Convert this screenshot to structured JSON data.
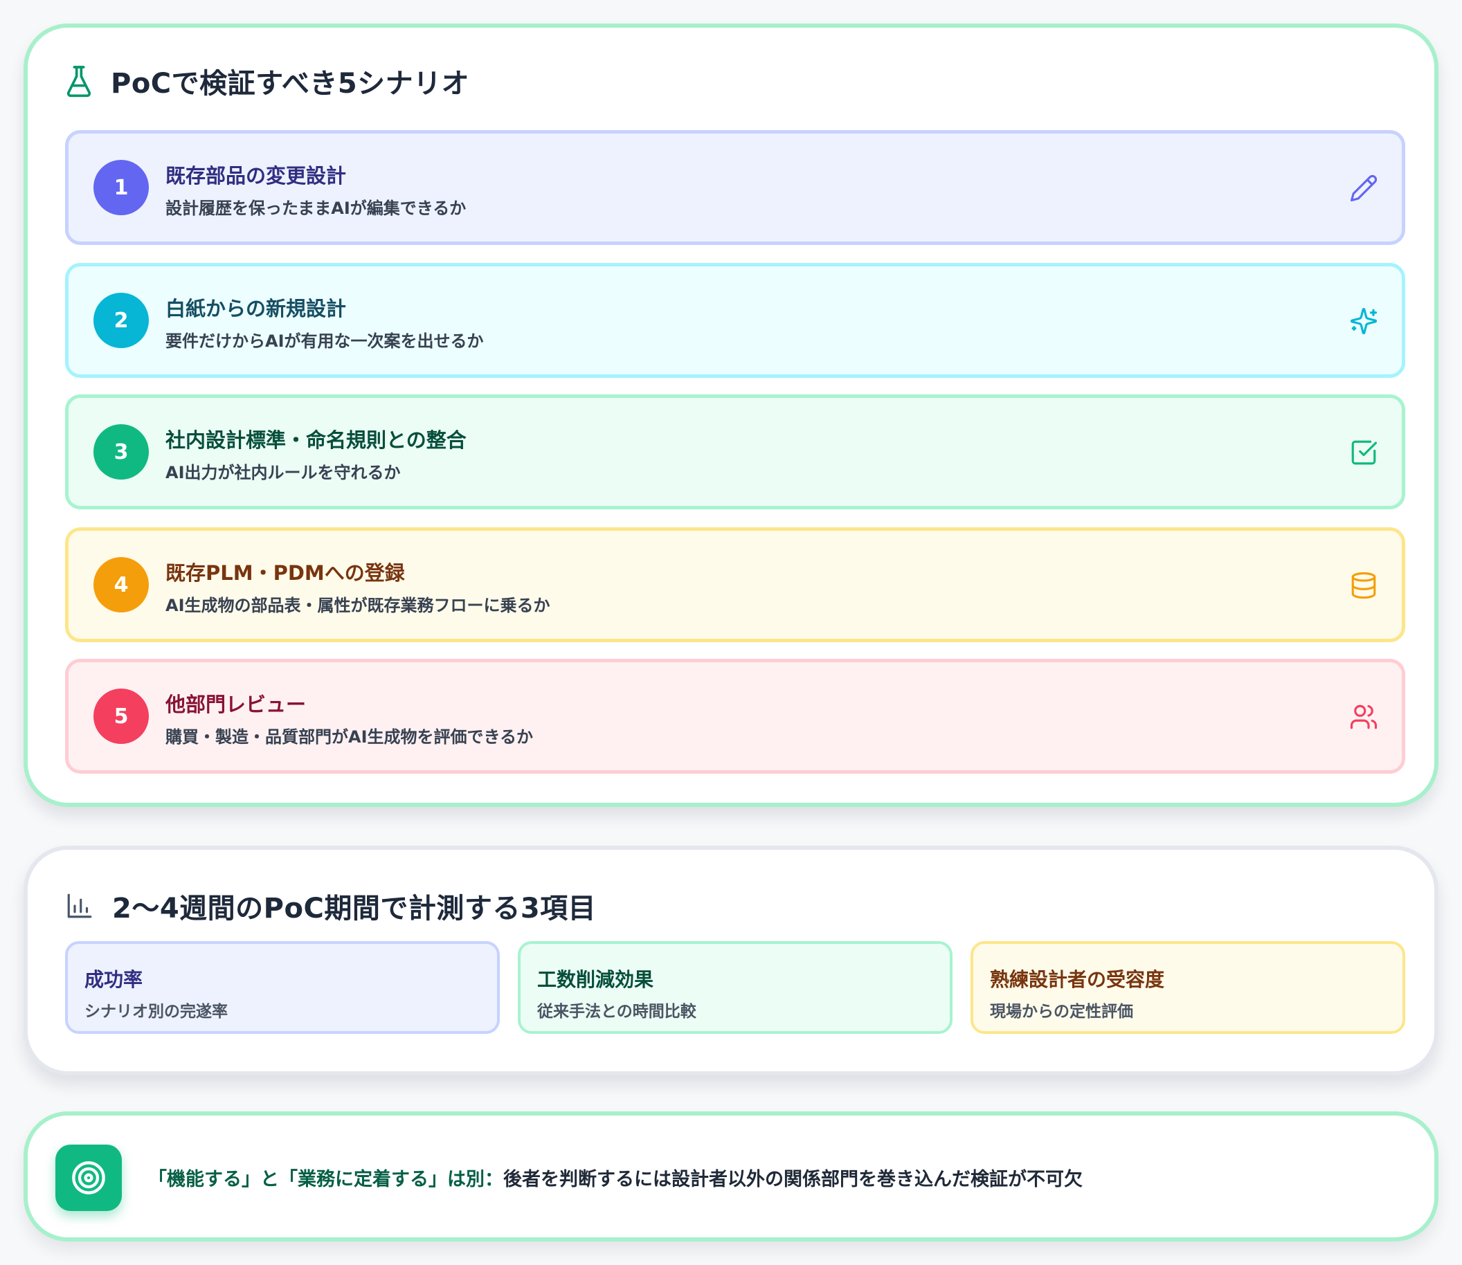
{
  "scenarios_section": {
    "title": "PoCで検証すべき5シナリオ",
    "icon": "flask-icon",
    "items": [
      {
        "number": "1",
        "title": "既存部品の変更設計",
        "description": "設計履歴を保ったままAIが編集できるか",
        "icon": "pencil-icon",
        "accent": "#6366f1",
        "title_color": "#312e81",
        "bg": "#eef2ff",
        "border": "#c7d2fe"
      },
      {
        "number": "2",
        "title": "白紙からの新規設計",
        "description": "要件だけからAIが有用な一次案を出せるか",
        "icon": "sparkles-icon",
        "accent": "#06b6d4",
        "title_color": "#164e63",
        "bg": "#ecfeff",
        "border": "#a5f3fc"
      },
      {
        "number": "3",
        "title": "社内設計標準・命名規則との整合",
        "description": "AI出力が社内ルールを守れるか",
        "icon": "check-square-icon",
        "accent": "#10b981",
        "title_color": "#064e3b",
        "bg": "#ecfdf5",
        "border": "#a7f3d0"
      },
      {
        "number": "4",
        "title": "既存PLM・PDMへの登録",
        "description": "AI生成物の部品表・属性が既存業務フローに乗るか",
        "icon": "database-icon",
        "accent": "#f59e0b",
        "title_color": "#78350f",
        "bg": "#fffbeb",
        "border": "#fde68a"
      },
      {
        "number": "5",
        "title": "他部門レビュー",
        "description": "購買・製造・品質部門がAI生成物を評価できるか",
        "icon": "users-icon",
        "accent": "#f43f5e",
        "title_color": "#881337",
        "bg": "#fff1f2",
        "border": "#fecdd3"
      }
    ]
  },
  "metrics_section": {
    "title": "2〜4週間のPoC期間で計測する3項目",
    "icon": "bar-chart-icon",
    "items": [
      {
        "title": "成功率",
        "description": "シナリオ別の完遂率",
        "title_color": "#312e81",
        "bg": "#eef2ff",
        "border": "#c7d2fe"
      },
      {
        "title": "工数削減効果",
        "description": "従来手法との時間比較",
        "title_color": "#064e3b",
        "bg": "#ecfdf5",
        "border": "#a7f3d0"
      },
      {
        "title": "熟練設計者の受容度",
        "description": "現場からの定性評価",
        "title_color": "#78350f",
        "bg": "#fffbeb",
        "border": "#fde68a"
      }
    ]
  },
  "conclusion": {
    "icon": "target-icon",
    "highlight": "「機能する」と「業務に定着する」は別：",
    "text": "後者を判断するには設計者以外の関係部門を巻き込んだ検証が不可欠"
  }
}
